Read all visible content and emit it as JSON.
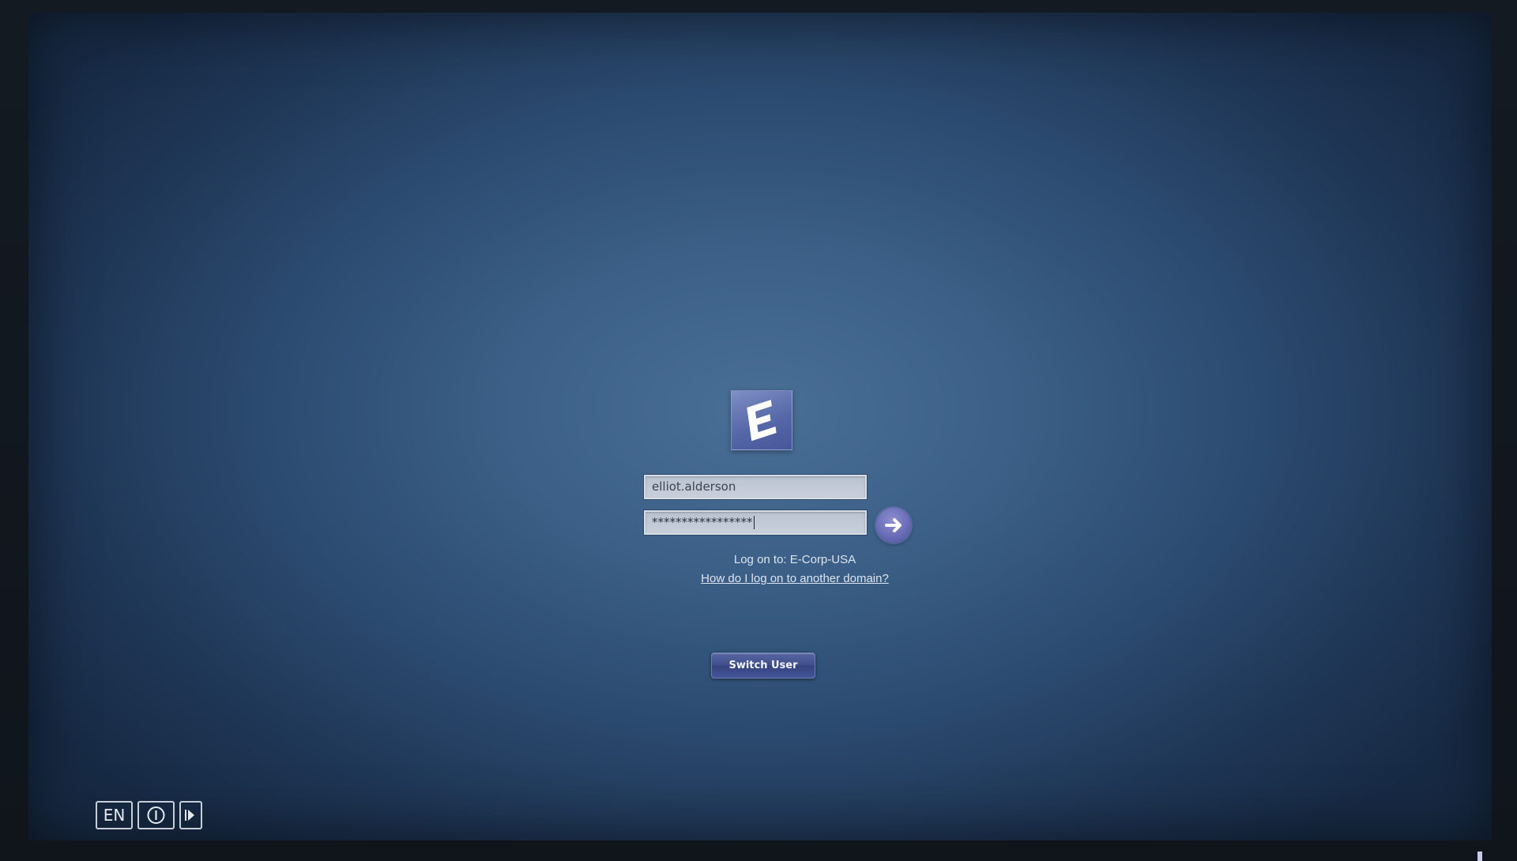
{
  "login": {
    "logo_letter": "E",
    "username_value": "elliot.alderson",
    "password_mask": "*****************",
    "logon_to_text": "Log on to: E-Corp-USA",
    "domain_help_link": "How do I log on to another domain?",
    "switch_user_label": "Switch User"
  },
  "bottom_bar": {
    "language_label": "EN",
    "accessibility_icon": "ease-of-access-icon",
    "power_icon": "shutdown-options-icon"
  },
  "colors": {
    "background_center": "#4a6f96",
    "background_edge": "#172a44",
    "logo_tile": "#5668a8",
    "go_button": "#6a6db8",
    "text": "#dde4ee"
  }
}
